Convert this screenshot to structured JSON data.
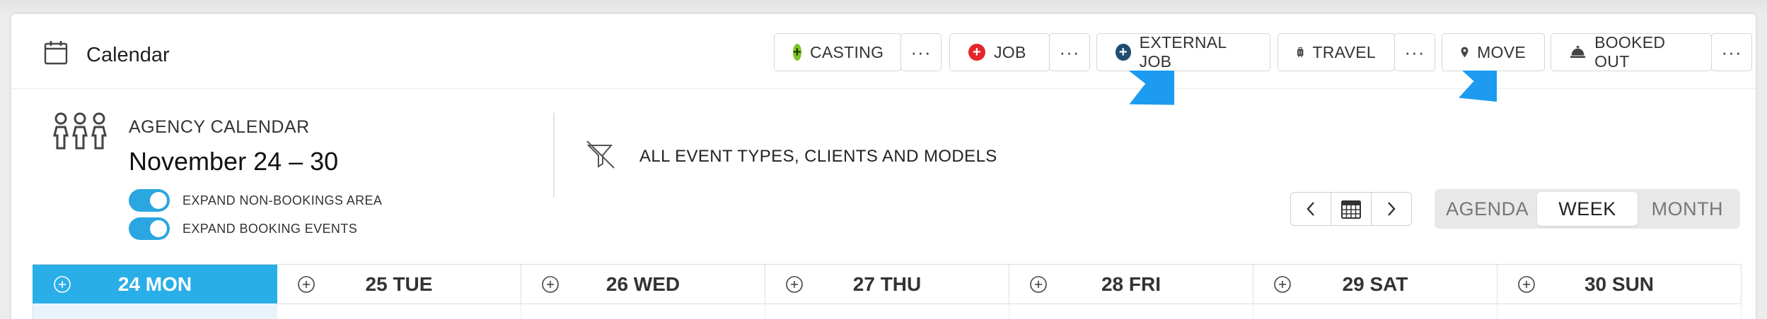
{
  "header": {
    "title": "Calendar",
    "icon": "calendar-icon"
  },
  "toolbar": {
    "casting": {
      "label": "CASTING",
      "color": "#7dc42a"
    },
    "job": {
      "label": "JOB",
      "color": "#e5262b"
    },
    "external_job": {
      "label": "EXTERNAL JOB",
      "color": "#1f4e73"
    },
    "travel": {
      "label": "TRAVEL",
      "icon": "luggage-icon"
    },
    "move": {
      "label": "MOVE",
      "icon": "map-pin-icon"
    },
    "booked_out": {
      "label": "BOOKED OUT",
      "icon": "service-bell-icon"
    },
    "more_label": "···"
  },
  "agency": {
    "label": "AGENCY CALENDAR",
    "date_range": "November 24 – 30",
    "toggles": [
      {
        "label": "EXPAND NON-BOOKINGS AREA",
        "on": true
      },
      {
        "label": "EXPAND BOOKING EVENTS",
        "on": true
      }
    ]
  },
  "filter": {
    "label": "ALL EVENT TYPES, CLIENTS AND MODELS",
    "icon": "filter-off-icon"
  },
  "views": {
    "agenda": "AGENDA",
    "week": "WEEK",
    "month": "MONTH",
    "active": "WEEK"
  },
  "days": [
    {
      "label": "24 MON",
      "active": true
    },
    {
      "label": "25 TUE",
      "active": false
    },
    {
      "label": "26 WED",
      "active": false
    },
    {
      "label": "27 THU",
      "active": false
    },
    {
      "label": "28 FRI",
      "active": false
    },
    {
      "label": "29 SAT",
      "active": false
    },
    {
      "label": "30 SUN",
      "active": false
    }
  ],
  "colors": {
    "accent": "#2aaee8",
    "annotation_arrow": "#1d9bf0"
  }
}
